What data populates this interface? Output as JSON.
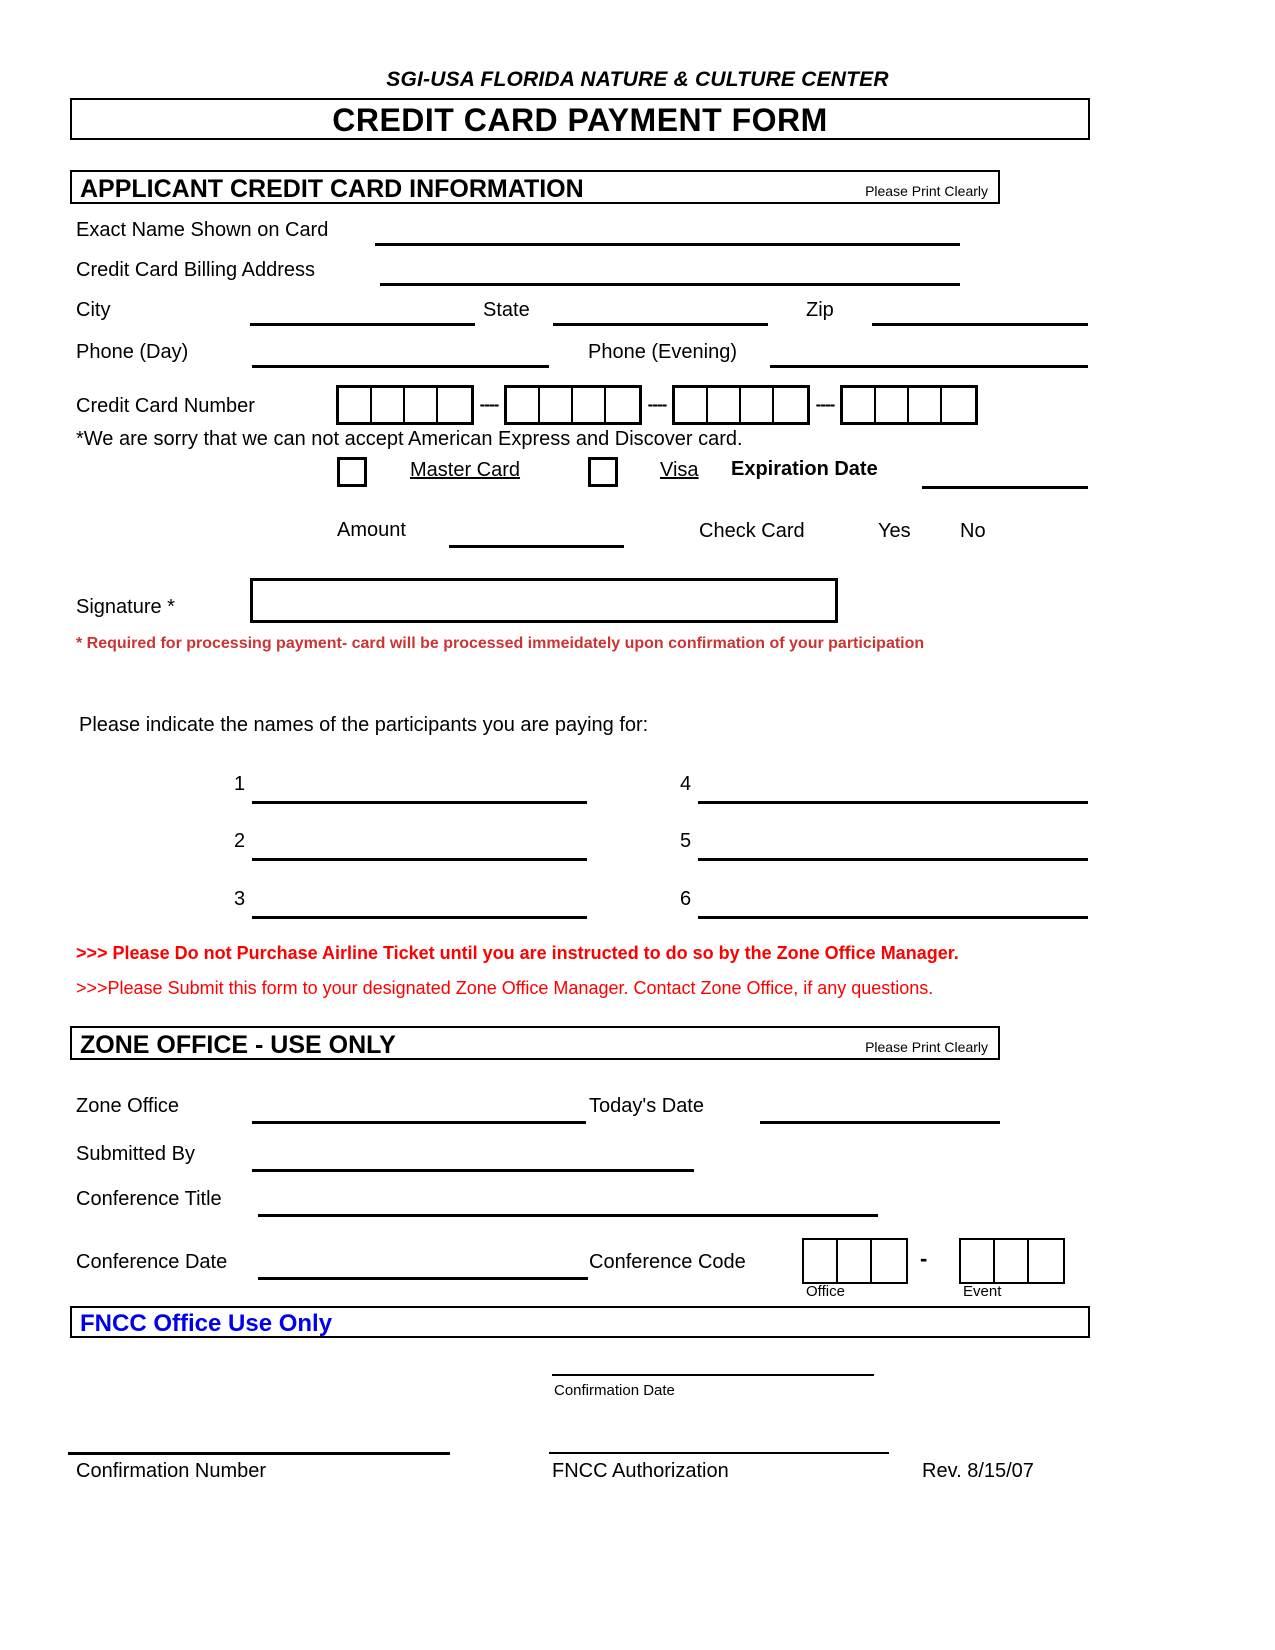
{
  "header": {
    "organization": "SGI-USA FLORIDA NATURE & CULTURE CENTER",
    "form_title": "CREDIT CARD PAYMENT FORM"
  },
  "applicant_section": {
    "title": "APPLICANT CREDIT CARD INFORMATION",
    "print_note": "Please Print Clearly",
    "labels": {
      "exact_name": "Exact Name Shown on Card",
      "billing_address": "Credit Card Billing Address",
      "city": "City",
      "state": "State",
      "zip": "Zip",
      "phone_day": "Phone (Day)",
      "phone_evening": "Phone (Evening)",
      "credit_card_number": "Credit Card Number",
      "master_card": "Master Card",
      "visa": "Visa",
      "expiration_date": "Expiration Date",
      "amount": "Amount",
      "check_card": "Check Card",
      "yes": "Yes",
      "no": "No",
      "signature": "Signature *"
    },
    "card_disclaimer": "*We are sorry that we can not accept American Express and Discover card.",
    "signature_note": "* Required for processing payment- card will be processed immeidately upon confirmation of your participation",
    "card_number_groups": 4,
    "card_number_cells_per_group": 4,
    "card_group_separator": "----"
  },
  "participants": {
    "prompt": "Please indicate the names of the participants you are paying for:",
    "numbers_left": [
      "1",
      "2",
      "3"
    ],
    "numbers_right": [
      "4",
      "5",
      "6"
    ]
  },
  "warnings": {
    "airline": ">>> Please Do not Purchase Airline Ticket until you are instructed to do so by the Zone Office Manager.",
    "submit": ">>>Please Submit this form to your designated Zone Office Manager. Contact Zone Office, if any questions."
  },
  "zone_section": {
    "title": "ZONE OFFICE - USE ONLY",
    "print_note": "Please Print Clearly",
    "labels": {
      "zone_office": "Zone Office",
      "todays_date": "Today's Date",
      "submitted_by": "Submitted By",
      "conference_title": "Conference Title",
      "conference_date": "Conference Date",
      "conference_code": "Conference Code",
      "office": "Office",
      "event": "Event"
    },
    "code_dash": "-",
    "office_cells": 3,
    "event_cells": 3
  },
  "fncc_section": {
    "title": "FNCC Office Use Only",
    "labels": {
      "confirmation_date": "Confirmation Date",
      "confirmation_number": "Confirmation Number",
      "fncc_authorization": "FNCC Authorization",
      "revision": "Rev. 8/15/07"
    }
  },
  "colors": {
    "red_note": "#cc3333",
    "red_warning": "#ff0000",
    "blue_heading": "#0000ee",
    "ink": "#000000"
  }
}
